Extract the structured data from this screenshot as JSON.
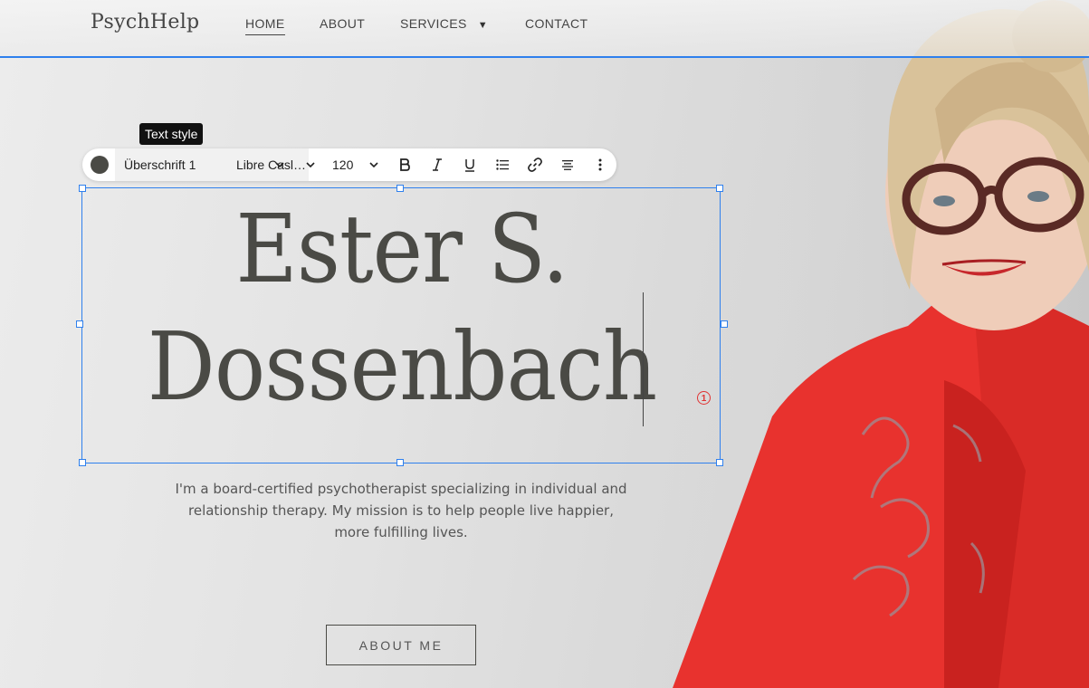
{
  "header": {
    "logo": "PsychHelp",
    "nav": [
      {
        "label": "HOME"
      },
      {
        "label": "ABOUT"
      },
      {
        "label": "SERVICES"
      },
      {
        "label": "CONTACT"
      }
    ]
  },
  "tooltip": "Text style",
  "toolbar": {
    "text_style": "Überschrift 1",
    "font": "Libre Casl…",
    "font_size": "120",
    "color": "#4a4a45"
  },
  "hero": {
    "heading_line1": "Ester S.",
    "heading_line2": "Dossenbach",
    "badge": "1",
    "paragraph": "I'm a board-certified psychotherapist specializing in individual and relationship therapy. My mission is to help people live happier, more fulfilling lives.",
    "button": "ABOUT ME"
  },
  "colors": {
    "selection": "#2f80ed",
    "heading": "#4a4a45",
    "scarf": "#e8322e"
  }
}
